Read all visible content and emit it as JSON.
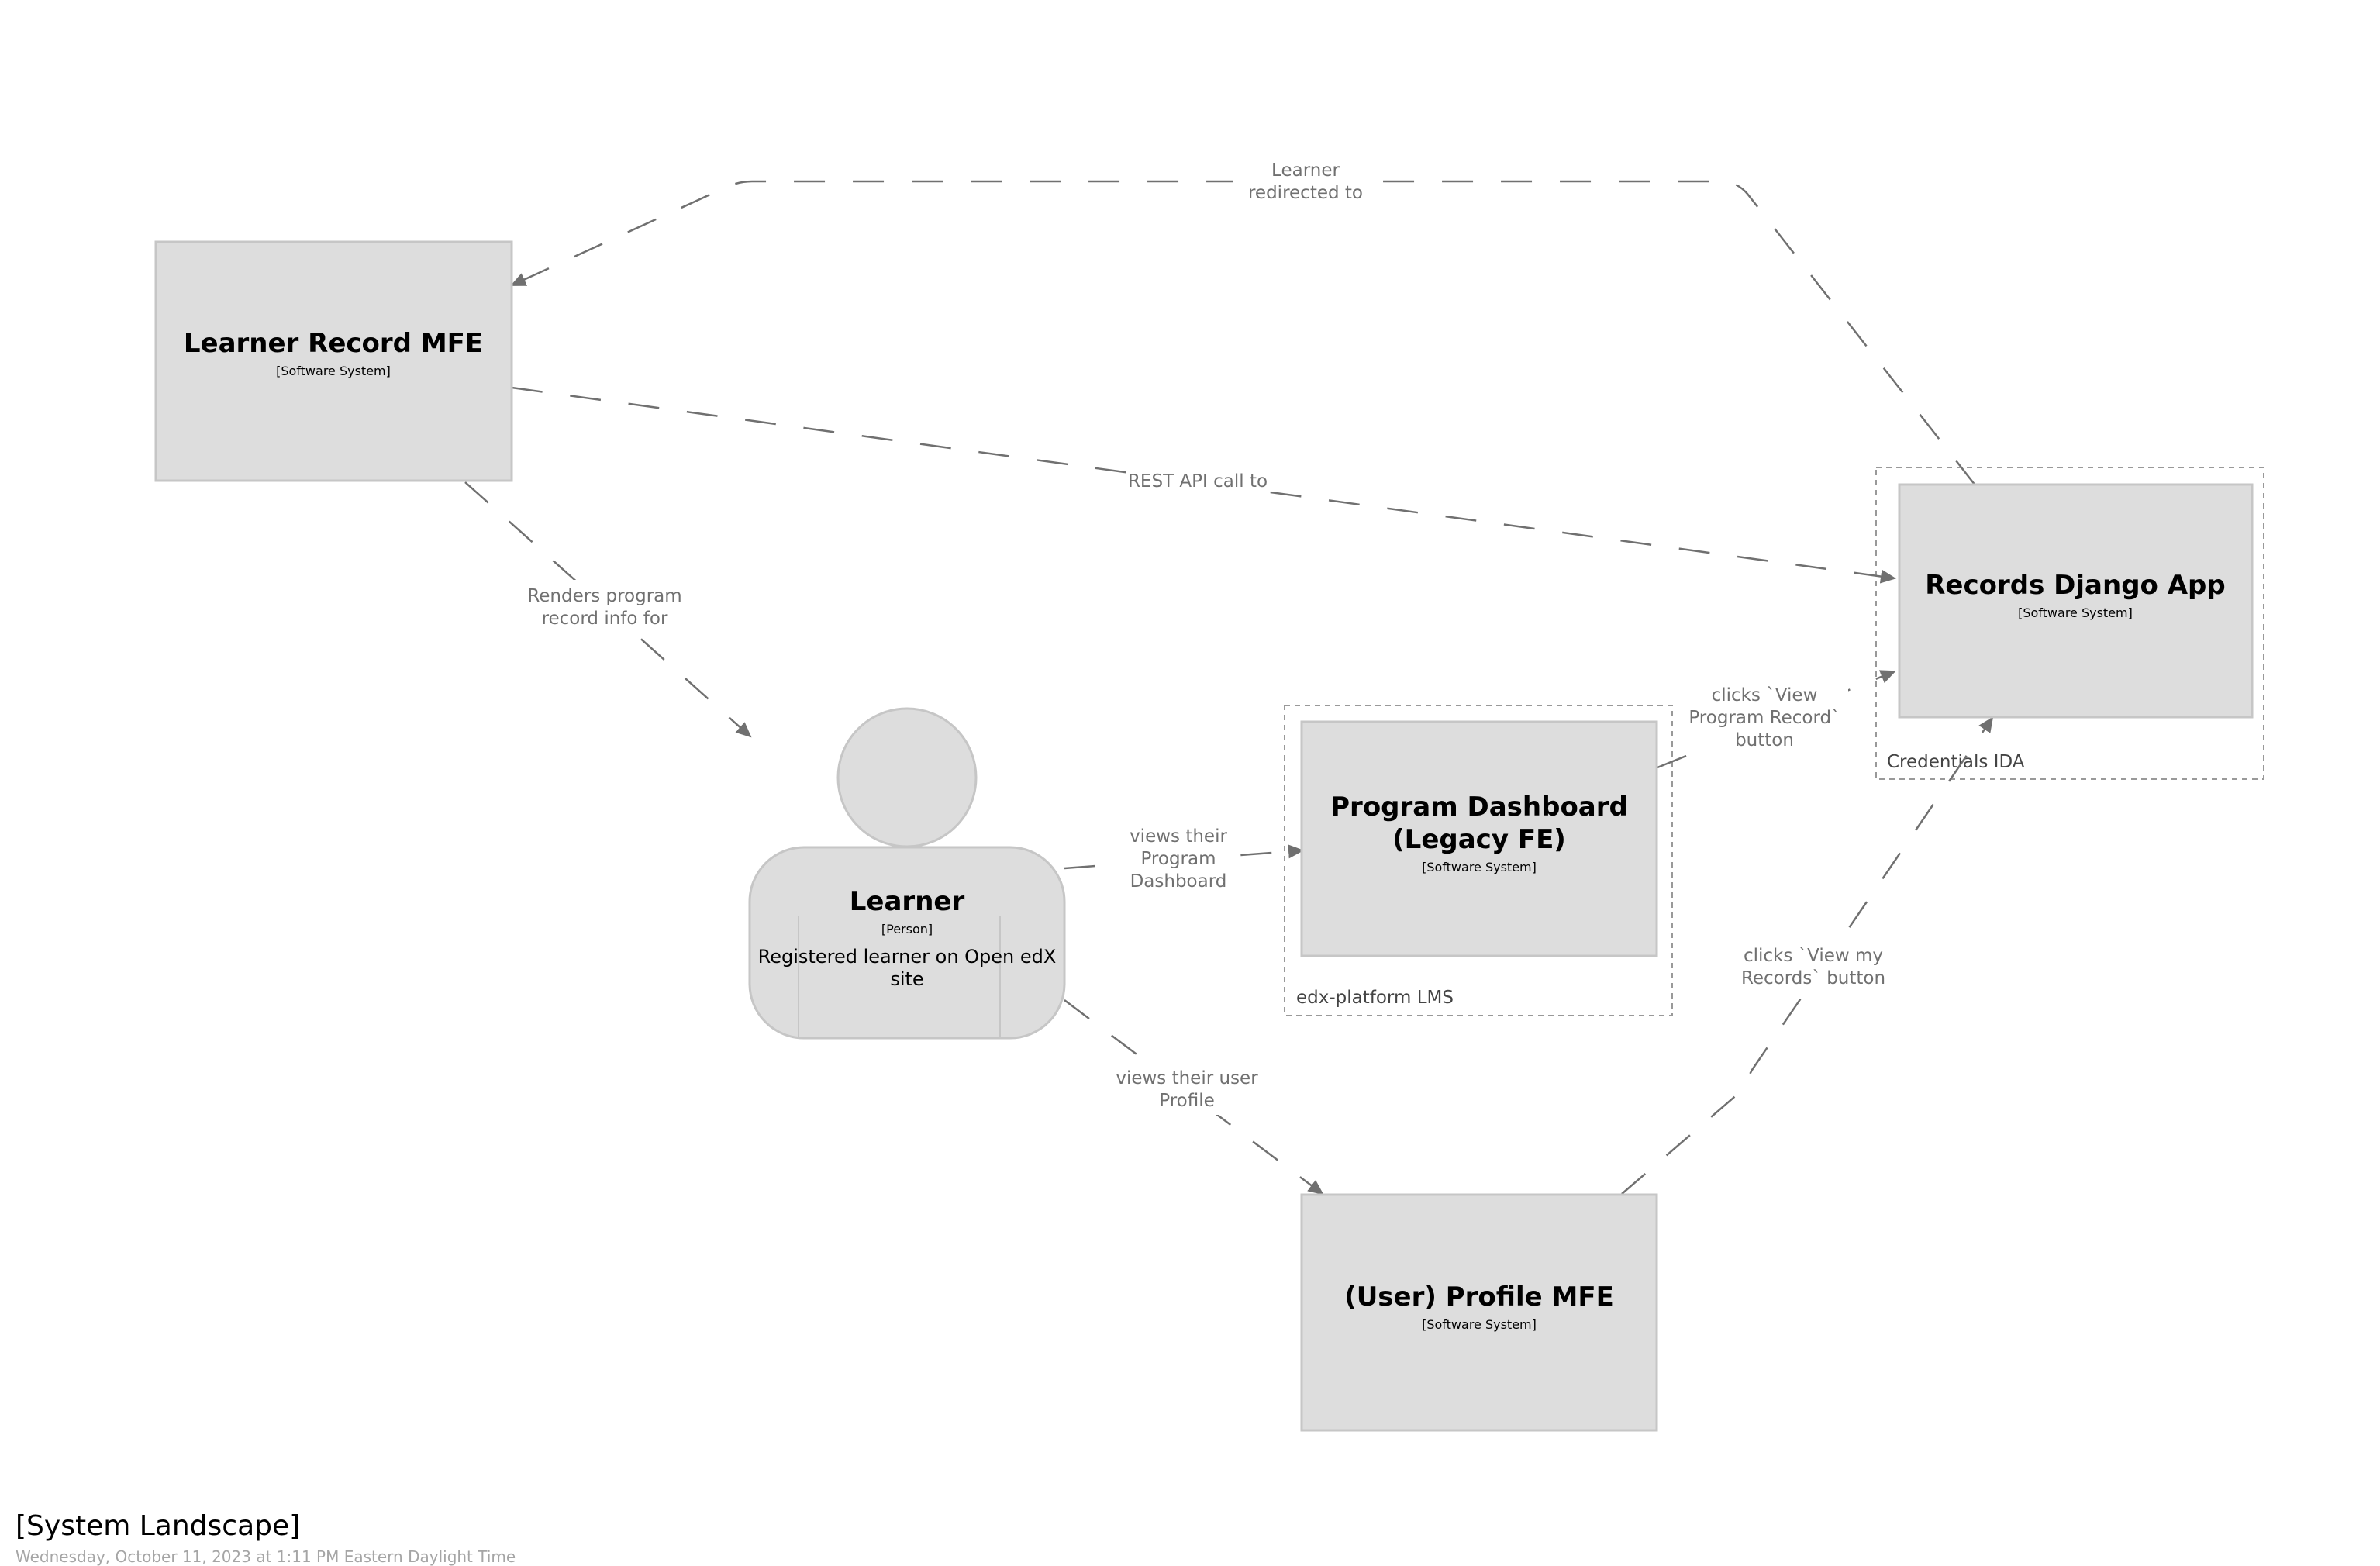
{
  "diagram": {
    "title": "[System Landscape]",
    "timestamp": "Wednesday, October 11, 2023 at 1:11 PM Eastern Daylight Time",
    "colors": {
      "element_fill": "#dddddd",
      "element_border": "#c6c6c6",
      "edge": "#707070",
      "edge_label": "#707070",
      "boundary": "#999999",
      "boundary_label": "#444444",
      "timestamp": "#a5a5a5"
    }
  },
  "boundaries": {
    "credentials": {
      "label": "Credentials IDA"
    },
    "lms": {
      "label": "edx-platform LMS"
    }
  },
  "nodes": {
    "learner_record_mfe": {
      "title": "Learner Record MFE",
      "type": "[Software System]"
    },
    "records_django_app": {
      "title": "Records Django App",
      "type": "[Software System]"
    },
    "program_dashboard": {
      "title_lines": [
        "Program Dashboard",
        "(Legacy FE)"
      ],
      "type": "[Software System]"
    },
    "profile_mfe": {
      "title": "(User) Profile MFE",
      "type": "[Software System]"
    },
    "learner": {
      "title": "Learner",
      "type": "[Person]",
      "description_lines": [
        "Registered learner on Open edX",
        "site"
      ]
    }
  },
  "relationships": {
    "redirect": {
      "from": "Records Django App",
      "to": "Learner Record MFE",
      "label_lines": [
        "Learner",
        "redirected to"
      ]
    },
    "rest_api": {
      "from": "Learner Record MFE",
      "to": "Records Django App",
      "label_lines": [
        "REST API call to"
      ]
    },
    "renders": {
      "from": "Learner Record MFE",
      "to": "Learner",
      "label_lines": [
        "Renders program",
        "record info for"
      ]
    },
    "views_dashboard": {
      "from": "Learner",
      "to": "Program Dashboard (Legacy FE)",
      "label_lines": [
        "views their",
        "Program",
        "Dashboard"
      ]
    },
    "view_program_record": {
      "from": "Program Dashboard (Legacy FE)",
      "to": "Records Django App",
      "label_lines": [
        "clicks `View",
        "Program Record`",
        "button"
      ]
    },
    "views_profile": {
      "from": "Learner",
      "to": "(User) Profile MFE",
      "label_lines": [
        "views their user",
        "Profile"
      ]
    },
    "view_my_records": {
      "from": "(User) Profile MFE",
      "to": "Records Django App",
      "label_lines": [
        "clicks `View my",
        "Records` button"
      ]
    }
  }
}
